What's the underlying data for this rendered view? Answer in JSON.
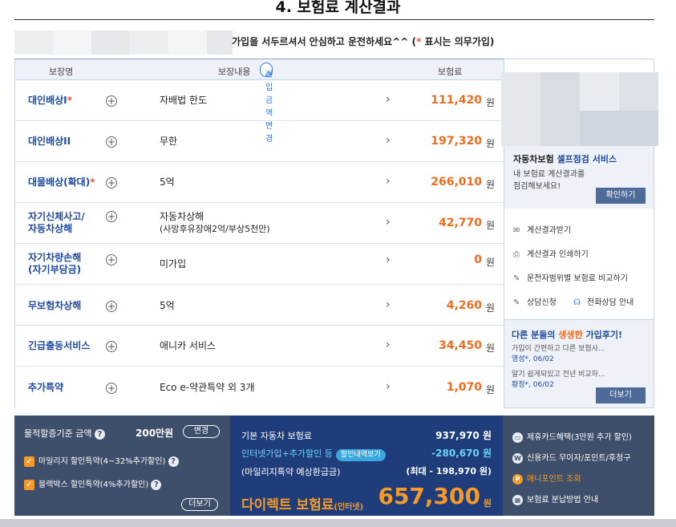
{
  "page": {
    "title": "4. 보험료 계산결과",
    "notice_text": "가입을 서두르셔서 안심하고 운전하세요^^ (",
    "notice_star": "*",
    "notice_tail": " 표시는 의무가입)"
  },
  "table": {
    "headers": {
      "name": "보장명",
      "content": "보장내용",
      "premium": "보험료"
    },
    "change_button": "가입금액 변경",
    "rows": [
      {
        "name": "대인배상I",
        "star": "*",
        "content": "자배법 한도",
        "content_sub": "",
        "amount": "111,420",
        "won": "원"
      },
      {
        "name": "대인배상II",
        "star": "",
        "content": "무한",
        "content_sub": "",
        "amount": "197,320",
        "won": "원"
      },
      {
        "name": "대물배상(확대)",
        "star": "*",
        "content": "5억",
        "content_sub": "",
        "amount": "266,010",
        "won": "원"
      },
      {
        "name": "자기신체사고/",
        "name2": "자동차상해",
        "star": "",
        "content": "자동차상해",
        "content_sub": "(사망후유장애2억/부상5천만)",
        "amount": "42,770",
        "won": "원"
      },
      {
        "name": "자기차량손해",
        "name2": "(자기부담금)",
        "star": "",
        "content": "미가입",
        "content_sub": "",
        "amount": "0",
        "won": "원"
      },
      {
        "name": "무보험차상해",
        "star": "",
        "content": "5억",
        "content_sub": "",
        "amount": "4,260",
        "won": "원"
      },
      {
        "name": "긴급출동서비스",
        "star": "",
        "content": "애니카 서비스",
        "content_sub": "",
        "amount": "34,450",
        "won": "원"
      },
      {
        "name": "추가특약",
        "star": "",
        "content": "Eco e-약관특약 외 3개",
        "content_sub": "",
        "amount": "1,070",
        "won": "원"
      }
    ]
  },
  "side": {
    "self_title_a": "자동차보험 ",
    "self_title_b": "셀프점검 서비스",
    "self_desc": "내 보험료 계산결과를\n점검해보세요!",
    "confirm_button": "확인하기",
    "menu": {
      "receive": "계산결과받기",
      "print": "계산결과 인쇄하기",
      "compare": "운전자범위별 보험료 비교하기",
      "consult": "상담신청",
      "phone": "전화상담 안내"
    },
    "reviews": {
      "title_a": "다른 분들의 ",
      "title_b": "생생한",
      "title_c": " 가입후기!",
      "items": [
        {
          "text": "가입이 간편하고 다른 보험사...",
          "who": "영성*, 06/02"
        },
        {
          "text": "알기 쉽게되있고 전년 비교하...",
          "who": "황정*, 06/02"
        }
      ],
      "more_button": "더보기"
    }
  },
  "bottom": {
    "left": {
      "mileage_label": "물적할증기준 금액",
      "mileage_amount": "200만원",
      "change_button": "변경",
      "check1": "마일리지 할인특약(4~32%추가할인)",
      "check2": "블랙박스 할인특약(4%추가할인)",
      "more_button": "더보기"
    },
    "mid": {
      "base_label": "기본 자동차 보험료",
      "base_value": "937,970 원",
      "discount_label": "인터넷가입+추가할인 등",
      "discount_button": "할인내역보기",
      "discount_value": "-280,670 원",
      "refund_label": "(마일리지특약 예상환급금)",
      "refund_value": "(최대 - 198,970 원)",
      "direct_label": "다이렉트 보험료",
      "direct_small": "(인터넷)",
      "total": "657,300",
      "total_won": "원"
    },
    "right": {
      "card": "제휴카드혜택(3만원 추가 할인)",
      "credit": "신용카드 무이자/포인트/후청구",
      "point": "애니포인트 조회",
      "installment": "보험료 분납방법 안내"
    }
  }
}
